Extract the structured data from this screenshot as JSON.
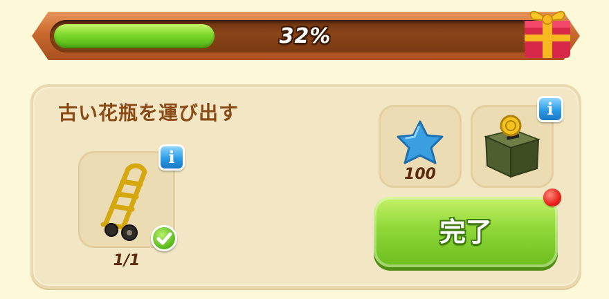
{
  "progress": {
    "percent_label": "32%",
    "fraction": 0.32
  },
  "task": {
    "title": "古い花瓶を運び出す",
    "requirement": {
      "item_icon": "hand-truck-icon",
      "count_label": "1/1",
      "completed": true
    },
    "rewards": [
      {
        "icon": "blue-star-icon",
        "amount_label": "100"
      },
      {
        "icon": "coin-box-icon"
      }
    ],
    "complete_button_label": "完了"
  },
  "colors": {
    "accent_green": "#7bd82a",
    "frame_brown": "#c9682e",
    "title_brown": "#8a4a16",
    "info_blue": "#2b9be6"
  }
}
